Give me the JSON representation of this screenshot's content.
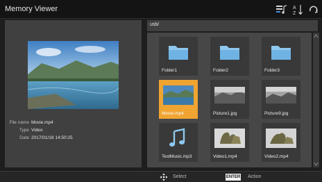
{
  "header": {
    "title": "Memory Viewer",
    "icons": [
      "playlist-music-icon",
      "sort-az-icon",
      "repeat-icon"
    ]
  },
  "info": {
    "file_name_label": "File name",
    "file_name": "Movie.mp4",
    "type_label": "Type",
    "type": "Video",
    "date_label": "Date",
    "date": "2017/01/18  14:50:25"
  },
  "browser": {
    "path": "usb/",
    "items": [
      {
        "label": "Folder1",
        "kind": "folder"
      },
      {
        "label": "Folder2",
        "kind": "folder"
      },
      {
        "label": "Folder3",
        "kind": "folder"
      },
      {
        "label": "Movie.mp4",
        "kind": "video",
        "selected": true
      },
      {
        "label": "Picture1.jpg",
        "kind": "image"
      },
      {
        "label": "Picture9.jpg",
        "kind": "image"
      },
      {
        "label": "TestMusic.mp3",
        "kind": "music"
      },
      {
        "label": "Video1.mp4",
        "kind": "video"
      },
      {
        "label": "Video2.mp4",
        "kind": "video"
      }
    ]
  },
  "footer": {
    "select_label": "Select",
    "enter_key": "ENTER",
    "action_label": "Action"
  },
  "colors": {
    "selection": "#f0a431",
    "panel": "#404040",
    "background": "#1e1e1e"
  }
}
